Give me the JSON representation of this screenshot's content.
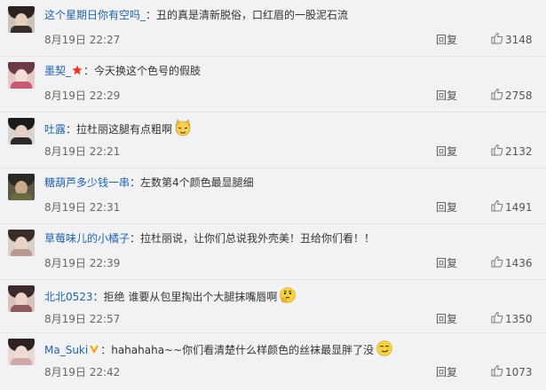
{
  "comments": [
    {
      "username": "这个星期日你有空吗_",
      "badge": "",
      "text": "：丑的真是清新脱俗，口红眉的一股泥石流",
      "emoji": "",
      "date": "8月19日 22:27",
      "reply_label": "回复",
      "likes": "3148",
      "avatar_colors": {
        "bg": "#c9c2b9",
        "hair": "#2b2420",
        "face": "#e8cdb8",
        "body": "#3a2e2a"
      }
    },
    {
      "username": "墨契_",
      "badge": "star",
      "text": "：今天换这个色号的假肢",
      "emoji": "",
      "date": "8月19日 22:29",
      "reply_label": "回复",
      "likes": "2758",
      "avatar_colors": {
        "bg": "#e6c8c4",
        "hair": "#6a3a48",
        "face": "#f2dcd4",
        "body": "#c75a74"
      }
    },
    {
      "username": "吐露",
      "badge": "",
      "text": "：拉杜丽这腿有点粗啊",
      "emoji": "cat",
      "date": "8月19日 22:21",
      "reply_label": "回复",
      "likes": "2132",
      "avatar_colors": {
        "bg": "#d8d4cf",
        "hair": "#1c1a1a",
        "face": "#e6cfc4",
        "body": "#2e2a2a"
      }
    },
    {
      "username": "糖葫芦多少钱一串",
      "badge": "",
      "text": "：左数第4个颜色最显腿细",
      "emoji": "",
      "date": "8月19日 22:31",
      "reply_label": "回复",
      "likes": "1491",
      "avatar_colors": {
        "bg": "#5c5a46",
        "hair": "#2a2822",
        "face": "#c9a88c",
        "body": "#6b6a40"
      }
    },
    {
      "username": "草莓味儿的小橘子",
      "badge": "",
      "text": "：拉杜丽说，让你们总说我外壳美！丑给你们看！！",
      "emoji": "",
      "date": "8月19日 22:39",
      "reply_label": "回复",
      "likes": "1436",
      "avatar_colors": {
        "bg": "#d9cfc9",
        "hair": "#3a2c26",
        "face": "#ead3c6",
        "body": "#b99a8e"
      }
    },
    {
      "username": "北北0523",
      "badge": "",
      "text": "：拒绝 谁要从包里掏出个大腿抹嘴唇啊",
      "emoji": "thinking",
      "date": "8月19日 22:57",
      "reply_label": "回复",
      "likes": "1350",
      "avatar_colors": {
        "bg": "#d6c3c0",
        "hair": "#3b2a2a",
        "face": "#ecd2c8",
        "body": "#8c5b5e"
      }
    },
    {
      "username": "Ma_Suki",
      "badge": "v",
      "text": "：hahahaha~~你们看清楚什么样颜色的丝袜最显胖了没",
      "emoji": "smirk",
      "date": "8月19日 22:42",
      "reply_label": "回复",
      "likes": "1073",
      "avatar_colors": {
        "bg": "#e9d8d3",
        "hair": "#2c2222",
        "face": "#f0dcd2",
        "body": "#cfa8a8"
      }
    }
  ],
  "icons": {
    "like": "thumbs-up-icon",
    "star_badge": "star-badge-icon",
    "v_badge": "verified-v-icon"
  },
  "colors": {
    "username": "#1f64a8",
    "text": "#333333",
    "meta": "#666666",
    "background": "#f2f2f5",
    "star": "#e8361e",
    "v": "#f0a500"
  }
}
